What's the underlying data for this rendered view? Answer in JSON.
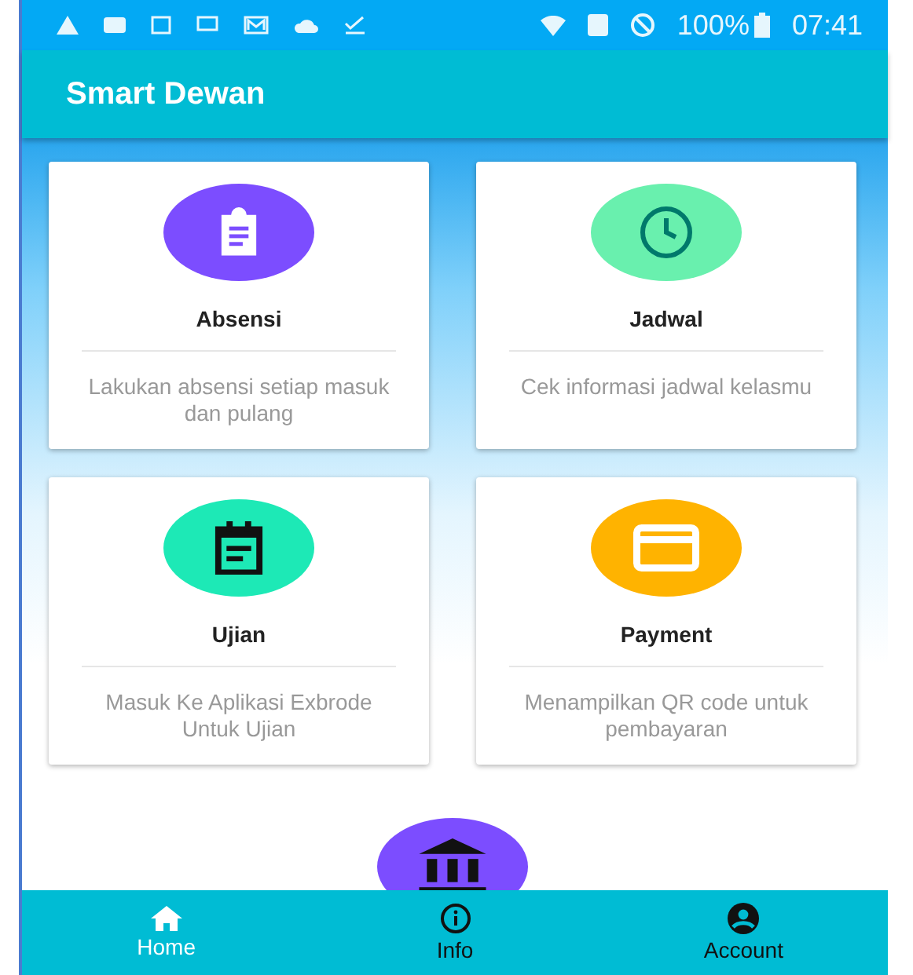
{
  "status_bar": {
    "battery": "100%",
    "time": "07:41"
  },
  "app_bar": {
    "title": "Smart Dewan"
  },
  "menu_cards": [
    {
      "kind": "clipboard",
      "title": "Absensi",
      "description": "Lakukan absensi setiap masuk dan pulang",
      "color": "#7c4dff"
    },
    {
      "kind": "clock",
      "title": "Jadwal",
      "description": "Cek informasi jadwal kelasmu",
      "color": "#69f0ae"
    },
    {
      "kind": "calendar",
      "title": "Ujian",
      "description": "Masuk Ke Aplikasi Exbrode Untuk Ujian",
      "color": "#1de9b6"
    },
    {
      "kind": "card",
      "title": "Payment",
      "description": "Menampilkan QR code untuk pembayaran",
      "color": "#ffb300"
    },
    {
      "kind": "bank",
      "color": "#7c4dff"
    }
  ],
  "bottom_nav": [
    {
      "kind": "home",
      "label": "Home",
      "selected": true
    },
    {
      "kind": "info",
      "label": "Info",
      "selected": false
    },
    {
      "kind": "account",
      "label": "Account",
      "selected": false
    }
  ]
}
